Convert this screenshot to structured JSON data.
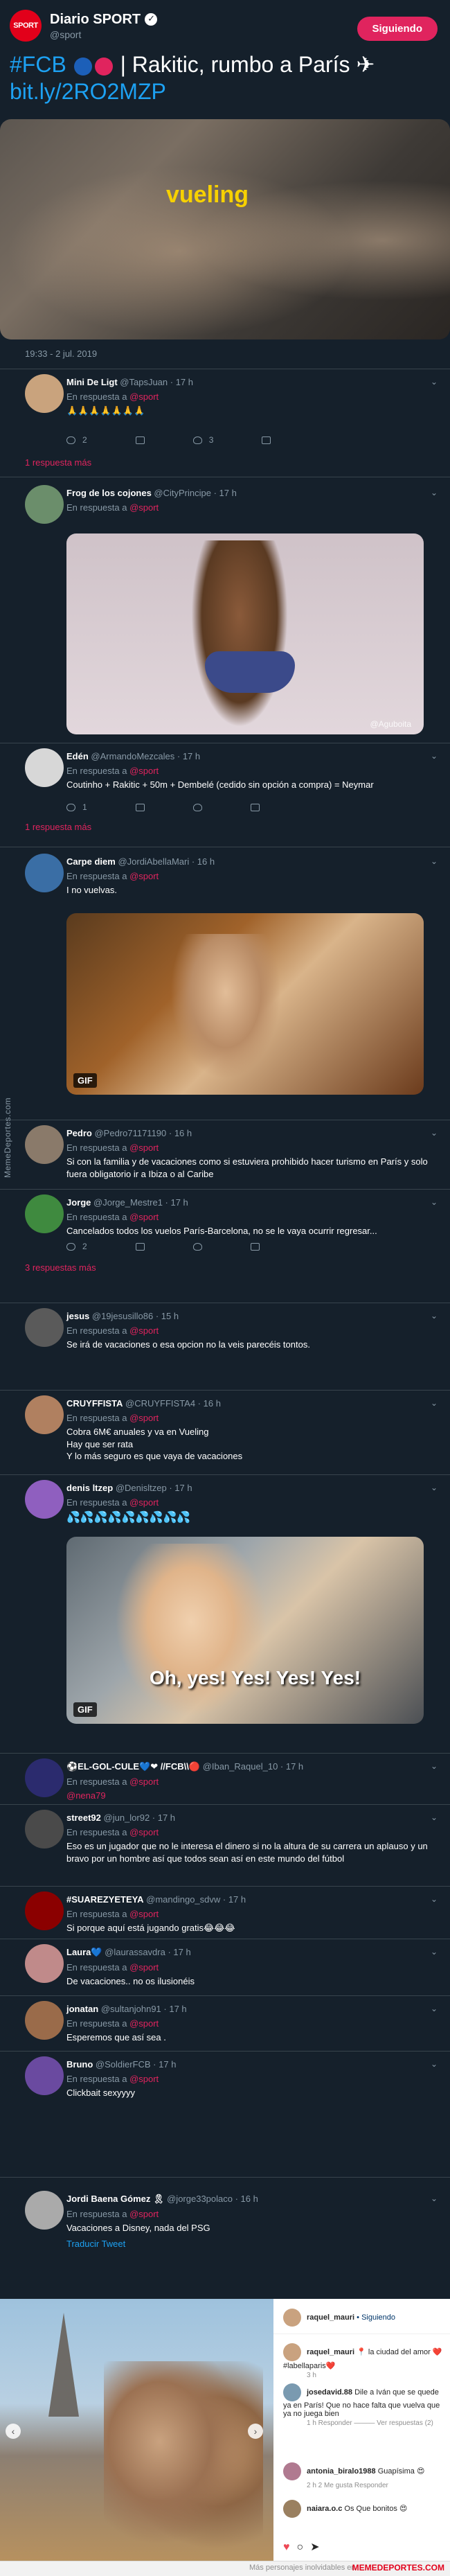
{
  "header": {
    "logo_text": "SPORT",
    "name": "Diario SPORT",
    "handle": "@sport",
    "follow_label": "Siguiendo",
    "tweet_hash": "#FCB",
    "tweet_rest": "| Rakitic, rumbo a París ✈",
    "tweet_link": "bit.ly/2RO2MZP",
    "video_brand": "vueling",
    "timestamp": "19:33 - 2 jul. 2019"
  },
  "replies": [
    {
      "name": "Mini De Ligt",
      "handle": "@TapsJuan · 17 h",
      "resp": "@sport",
      "text": "🙏🙏🙏🙏🙏🙏🙏",
      "replies": "2",
      "retweets": "",
      "likes": "3",
      "more": "1 respuesta más",
      "avatar": "#c9a37d"
    },
    {
      "name": "Frog de los cojones",
      "handle": "@CityPrincipe · 17 h",
      "resp": "@sport",
      "text": "",
      "media_label": "@Aguboita",
      "avatar": "#6b8e6b"
    },
    {
      "name": "Edén",
      "handle": "@ArmandoMezcales · 17 h",
      "resp": "@sport",
      "text": "Coutinho + Rakitic + 50m + Dembelé (cedido sin opción a compra) = Neymar",
      "replies": "1",
      "retweets": "",
      "likes": "",
      "more": "1 respuesta más",
      "avatar": "#d7d7d7"
    },
    {
      "name": "Carpe diem",
      "handle": "@JordiAbellaMari · 16 h",
      "resp": "@sport",
      "text": "I no vuelvas.",
      "gif": "GIF",
      "avatar": "#3a6ea5"
    },
    {
      "name": "Pedro",
      "handle": "@Pedro71171190 · 16 h",
      "resp": "@sport",
      "text": "Si con la familia y de vacaciones como si estuviera prohibido hacer turismo en París y solo fuera obligatorio ir a Ibiza o al Caribe",
      "avatar": "#8a7a6a"
    },
    {
      "name": "Jorge",
      "handle": "@Jorge_Mestre1 · 17 h",
      "resp": "@sport",
      "text": "Cancelados todos los vuelos París-Barcelona, no se le vaya ocurrir regresar...",
      "replies": "2",
      "retweets": "",
      "likes": "",
      "more": "3 respuestas más",
      "avatar": "#3f8a3f"
    },
    {
      "name": "jesus",
      "handle": "@19jesusillo86 · 15 h",
      "resp": "@sport",
      "text": "Se irá de vacaciones o esa opcion no la veis parecéis tontos.",
      "avatar": "#5a5a5a"
    },
    {
      "name": "CRUYFFISTA",
      "handle": "@CRUYFFISTA4 · 16 h",
      "resp": "@sport",
      "text": "Cobra 6M€ anuales y va en Vueling\nHay que ser rata\nY lo más seguro es que vaya de vacaciones",
      "avatar": "#b08060"
    },
    {
      "name": "denis ltzep",
      "handle": "@Denisltzep · 17 h",
      "resp": "@sport",
      "text": "💦💦💦💦💦💦💦💦💦",
      "gif": "GIF",
      "gif_caption": "Oh, yes! Yes! Yes! Yes!",
      "avatar": "#8f5fbf"
    },
    {
      "name": "⚽EL-GOL-CULE💙❤ //FCB\\\\🔴",
      "handle": "@Iban_Raquel_10 · 17 h",
      "resp": "@sport",
      "text": "@nena79",
      "avatar": "#2b2b6e"
    },
    {
      "name": "street92",
      "handle": "@jun_lor92 · 17 h",
      "resp": "@sport",
      "text": "Eso es un jugador que no le interesa el dinero si no la altura de su carrera un aplauso y un bravo por un hombre así que todos sean así en este mundo del fútbol",
      "avatar": "#4a4a4a"
    },
    {
      "name": "#SUAREZYETEYA",
      "handle": "@mandingo_sdvw · 17 h",
      "resp": "@sport",
      "text": "Si porque aquí está jugando gratis😂😂😂",
      "avatar": "#8b0000"
    },
    {
      "name": "Laura💙",
      "handle": "@laurassavdra · 17 h",
      "resp": "@sport",
      "text": "De vacaciones.. no os ilusionéis",
      "avatar": "#c08a8a"
    },
    {
      "name": "jonatan",
      "handle": "@sultanjohn91 · 17 h",
      "resp": "@sport",
      "text": "Esperemos que así sea .",
      "avatar": "#9a6b4a"
    },
    {
      "name": "Bruno",
      "handle": "@SoldierFCB · 17 h",
      "resp": "@sport",
      "text": "Clickbait sexyyyy",
      "avatar": "#6a4aa0"
    },
    {
      "name": "Jordi Baena Gómez 🎗",
      "handle": "@jorge33polaco · 16 h",
      "resp": "@sport",
      "text": "Vacaciones a Disney, nada del PSG",
      "translate": "Traducir Tweet",
      "avatar": "#aaaaaa"
    }
  ],
  "watermark_side": "MemeDeportes.com",
  "instagram": {
    "user": "raquel_mauri",
    "follow": "• Siguiendo",
    "comments": [
      {
        "user": "raquel_mauri",
        "text": "📍 la ciudad del amor ❤️ #labellaparis❤️",
        "meta": "3 h"
      },
      {
        "user": "josedavid.88",
        "text": "Dile a Iván que se quede ya en París! Que no hace falta que vuelva que ya no juega bien",
        "meta": "1 h   Responder   ——— Ver respuestas (2)"
      },
      {
        "user": "antonia_biralo1988",
        "text": "Guapísima 😍",
        "meta": "2 h   2 Me gusta   Responder"
      },
      {
        "user": "naiara.o.c",
        "text": "Os Que bonitos 😍",
        "meta": ""
      }
    ],
    "footer_left": "Más personajes inolvidables en",
    "footer_right": "MEMEDEPORTES.COM"
  },
  "colors": {
    "accent": "#1da1f2",
    "brand": "#e0245e",
    "background": "#15202b"
  }
}
